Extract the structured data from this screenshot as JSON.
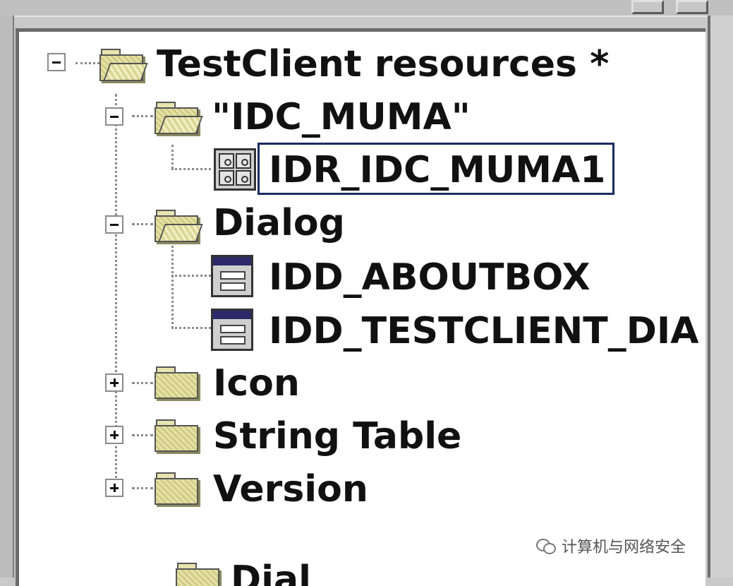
{
  "tree": {
    "root": {
      "label": "TestClient resources *",
      "expanded": true,
      "icon": "folder-open-icon"
    },
    "nodes": [
      {
        "label": "\"IDC_MUMA\"",
        "expanded": true,
        "icon": "folder-open-icon",
        "children": [
          {
            "label": "IDR_IDC_MUMA1",
            "icon": "accelerator-icon",
            "selected": true
          }
        ]
      },
      {
        "label": "Dialog",
        "expanded": true,
        "icon": "folder-open-icon",
        "children": [
          {
            "label": "IDD_ABOUTBOX",
            "icon": "dialog-icon"
          },
          {
            "label": "IDD_TESTCLIENT_DIA",
            "icon": "dialog-icon"
          }
        ]
      },
      {
        "label": "Icon",
        "expanded": false,
        "icon": "folder-closed-icon"
      },
      {
        "label": "String Table",
        "expanded": false,
        "icon": "folder-closed-icon"
      },
      {
        "label": "Version",
        "expanded": false,
        "icon": "folder-closed-icon"
      }
    ],
    "partial_bottom_label": "Dial"
  },
  "watermark": {
    "text": "计算机与网络安全"
  },
  "colors": {
    "selection_border": "#1c2a5e",
    "dialog_titlebar": "#2a2a6a",
    "folder_fill": "#e6e2a6"
  }
}
